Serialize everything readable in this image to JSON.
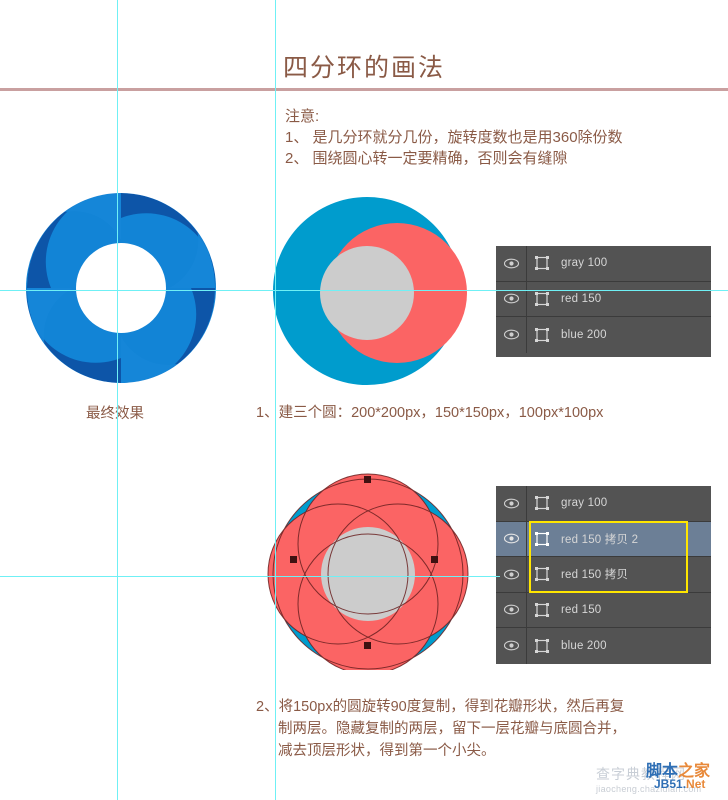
{
  "header": {
    "title": "四分环的画法",
    "rule_color": "#c9a0a0",
    "text_color": "#8a5a46"
  },
  "notes": {
    "heading": "注意:",
    "items": [
      "1、 是几分环就分几份，旋转度数也是用360除份数",
      "2、 围绕圆心转一定要精确，否则会有缝隙"
    ]
  },
  "captions": {
    "final_effect": "最终效果",
    "step1": "1、建三个圆：200*200px，150*150px，100px*100px",
    "step2_line1": "2、将150px的圆旋转90度复制，得到花瓣形状，然后再复",
    "step2_line2": "制两层。隐藏复制的两层，留下一层花瓣与底圆合并，",
    "step2_line3": "减去顶层形状，得到第一个小尖。"
  },
  "figures": {
    "final_ring": {
      "name": "四分环最终效果",
      "blue_light": "#1284d6",
      "blue_dark": "#0d55a8"
    },
    "three_circles": {
      "name": "三个圆",
      "blue": "#009ccd",
      "red": "#fb6464",
      "gray": "#cccccc",
      "sizes": [
        "200*200px",
        "150*150px",
        "100px*100px"
      ]
    },
    "petal_shape": {
      "name": "花瓣形状",
      "blue": "#009ccd",
      "red": "#fb6464",
      "gray": "#cccccc",
      "path_stroke": "#6a2020",
      "anchor_color": "#4a1414"
    }
  },
  "layers_panel_top": {
    "panel_bg": "#535353",
    "rows": [
      {
        "name": "gray 100",
        "visible": true,
        "selected": false
      },
      {
        "name": "red 150",
        "visible": true,
        "selected": false
      },
      {
        "name": "blue 200",
        "visible": true,
        "selected": false
      }
    ]
  },
  "layers_panel_bottom": {
    "panel_bg": "#535353",
    "selection_box_color": "#ffe600",
    "rows": [
      {
        "name": "gray 100",
        "visible": true,
        "selected": false
      },
      {
        "name": "red 150 拷贝 2",
        "visible": true,
        "selected": true
      },
      {
        "name": "red 150 拷贝",
        "visible": true,
        "selected": false
      },
      {
        "name": "red 150",
        "visible": true,
        "selected": false
      },
      {
        "name": "blue 200",
        "visible": true,
        "selected": false
      }
    ]
  },
  "guides": {
    "color": "#6ff0f5",
    "vertical_x": [
      117,
      275
    ],
    "horizontal_y": [
      290,
      576
    ]
  },
  "watermark": {
    "main_blue": "脚本",
    "main_orange": "之家",
    "sub_blue": "JB51.",
    "sub_orange": "Net",
    "faint_cn": "查字典教程网",
    "faint_url": "jiaocheng.chazidian.com"
  }
}
